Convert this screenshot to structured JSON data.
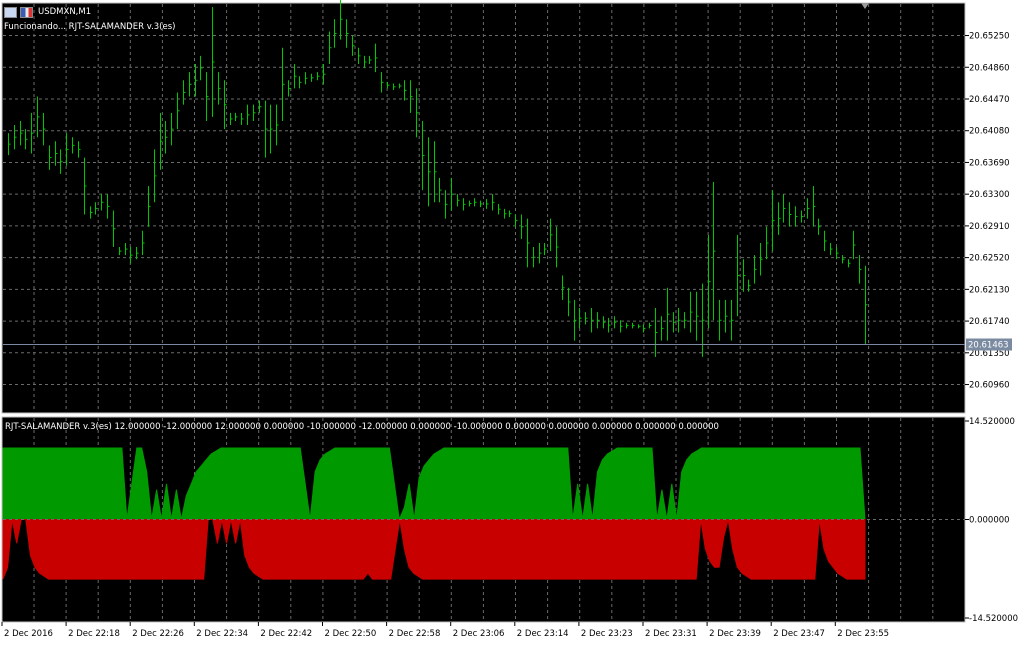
{
  "window": {
    "symbol_title": "USDMXN,M1",
    "status_text": "Funcionando... RJT-SALAMANDER v.3(es)"
  },
  "indicator": {
    "label": "RJT-SALAMANDER v.3(es) 12.000000 -12.000000 12.000000 0.000000 -10.000000 -12.000000 0.000000 -10.000000 0.000000 0.000000 0.000000 0.000000 0.000000",
    "axis_labels": [
      "14.520000",
      "0.000000",
      "-14.520000"
    ]
  },
  "colors": {
    "background": "#000000",
    "grid": "#6a6a6a",
    "candles": "#00c800",
    "bid_line": "#7a8aa0",
    "green_fill": "#009a00",
    "red_fill": "#c80000",
    "axis_panel": "#ffffff"
  },
  "price_axis": {
    "labels": [
      "20.65250",
      "20.64860",
      "20.64470",
      "20.64080",
      "20.63690",
      "20.63300",
      "20.62910",
      "20.62520",
      "20.62130",
      "20.61740",
      "20.61350",
      "20.60960"
    ],
    "current_price": "20.61463"
  },
  "time_axis": {
    "labels": [
      "2 Dec 2016",
      "2 Dec 22:18",
      "2 Dec 22:26",
      "2 Dec 22:34",
      "2 Dec 22:42",
      "2 Dec 22:50",
      "2 Dec 22:58",
      "2 Dec 23:06",
      "2 Dec 23:14",
      "2 Dec 23:23",
      "2 Dec 23:31",
      "2 Dec 23:39",
      "2 Dec 23:47",
      "2 Dec 23:55"
    ]
  },
  "chart_data": {
    "type": "line",
    "price_ylim": [
      20.6061,
      20.6565
    ],
    "bid": 20.61463,
    "price_bars_hl": [
      [
        20.6378,
        20.6405
      ],
      [
        20.6385,
        20.6415
      ],
      [
        20.639,
        20.642
      ],
      [
        20.6385,
        20.641
      ],
      [
        20.638,
        20.643
      ],
      [
        20.64,
        20.645
      ],
      [
        20.639,
        20.643
      ],
      [
        20.636,
        20.639
      ],
      [
        20.6365,
        20.6395
      ],
      [
        20.6355,
        20.6385
      ],
      [
        20.6365,
        20.6405
      ],
      [
        20.638,
        20.64
      ],
      [
        20.6375,
        20.6395
      ],
      [
        20.6305,
        20.6375
      ],
      [
        20.63,
        20.6315
      ],
      [
        20.6305,
        20.632
      ],
      [
        20.631,
        20.633
      ],
      [
        20.63,
        20.633
      ],
      [
        20.6265,
        20.631
      ],
      [
        20.6255,
        20.6265
      ],
      [
        20.6255,
        20.627
      ],
      [
        20.6245,
        20.6265
      ],
      [
        20.625,
        20.6265
      ],
      [
        20.6255,
        20.6285
      ],
      [
        20.629,
        20.634
      ],
      [
        20.632,
        20.6385
      ],
      [
        20.636,
        20.643
      ],
      [
        20.638,
        20.642
      ],
      [
        20.639,
        20.643
      ],
      [
        20.641,
        20.6455
      ],
      [
        20.644,
        20.647
      ],
      [
        20.645,
        20.648
      ],
      [
        20.645,
        20.649
      ],
      [
        20.647,
        20.65
      ],
      [
        20.642,
        20.648
      ],
      [
        20.6425,
        20.656
      ],
      [
        20.644,
        20.648
      ],
      [
        20.641,
        20.647
      ],
      [
        20.6415,
        20.643
      ],
      [
        20.642,
        20.643
      ],
      [
        20.6415,
        20.643
      ],
      [
        20.6415,
        20.644
      ],
      [
        20.642,
        20.644
      ],
      [
        20.643,
        20.6445
      ],
      [
        20.6375,
        20.6445
      ],
      [
        20.638,
        20.644
      ],
      [
        20.639,
        20.644
      ],
      [
        20.642,
        20.651
      ],
      [
        20.645,
        20.647
      ],
      [
        20.646,
        20.649
      ],
      [
        20.646,
        20.6475
      ],
      [
        20.6465,
        20.648
      ],
      [
        20.6468,
        20.6478
      ],
      [
        20.647,
        20.648
      ],
      [
        20.6465,
        20.649
      ],
      [
        20.649,
        20.653
      ],
      [
        20.651,
        20.6545
      ],
      [
        20.652,
        20.657
      ],
      [
        20.651,
        20.6545
      ],
      [
        20.65,
        20.6525
      ],
      [
        20.649,
        20.651
      ],
      [
        20.6485,
        20.65
      ],
      [
        20.649,
        20.65
      ],
      [
        20.648,
        20.6515
      ],
      [
        20.6455,
        20.648
      ],
      [
        20.646,
        20.6468
      ],
      [
        20.6458,
        20.6466
      ],
      [
        20.646,
        20.6466
      ],
      [
        20.6445,
        20.647
      ],
      [
        20.643,
        20.647
      ],
      [
        20.64,
        20.646
      ],
      [
        20.6335,
        20.642
      ],
      [
        20.6315,
        20.64
      ],
      [
        20.632,
        20.6395
      ],
      [
        20.632,
        20.635
      ],
      [
        20.63,
        20.6335
      ],
      [
        20.631,
        20.635
      ],
      [
        20.6315,
        20.633
      ],
      [
        20.631,
        20.6325
      ],
      [
        20.6315,
        20.6322
      ],
      [
        20.6315,
        20.6325
      ],
      [
        20.6314,
        20.6322
      ],
      [
        20.6312,
        20.6324
      ],
      [
        20.631,
        20.633
      ],
      [
        20.6305,
        20.6318
      ],
      [
        20.63,
        20.6312
      ],
      [
        20.6302,
        20.631
      ],
      [
        20.629,
        20.6305
      ],
      [
        20.6275,
        20.6305
      ],
      [
        20.624,
        20.63
      ],
      [
        20.624,
        20.6265
      ],
      [
        20.6245,
        20.627
      ],
      [
        20.6255,
        20.627
      ],
      [
        20.626,
        20.63
      ],
      [
        20.624,
        20.629
      ],
      [
        20.62,
        20.623
      ],
      [
        20.618,
        20.6215
      ],
      [
        20.615,
        20.62
      ],
      [
        20.6165,
        20.619
      ],
      [
        20.617,
        20.6185
      ],
      [
        20.616,
        20.619
      ],
      [
        20.6165,
        20.6185
      ],
      [
        20.6165,
        20.618
      ],
      [
        20.616,
        20.6178
      ],
      [
        20.6165,
        20.618
      ],
      [
        20.616,
        20.6175
      ],
      [
        20.6165,
        20.6172
      ],
      [
        20.6165,
        20.6172
      ],
      [
        20.6165,
        20.617
      ],
      [
        20.616,
        20.617
      ],
      [
        20.6165,
        20.6172
      ],
      [
        20.613,
        20.619
      ],
      [
        20.615,
        20.618
      ],
      [
        20.615,
        20.6215
      ],
      [
        20.616,
        20.6185
      ],
      [
        20.616,
        20.619
      ],
      [
        20.6165,
        20.6185
      ],
      [
        20.616,
        20.621
      ],
      [
        20.615,
        20.621
      ],
      [
        20.613,
        20.622
      ],
      [
        20.6165,
        20.628
      ],
      [
        20.6175,
        20.6345
      ],
      [
        20.615,
        20.62
      ],
      [
        20.616,
        20.62
      ],
      [
        20.615,
        20.62
      ],
      [
        20.618,
        20.628
      ],
      [
        20.621,
        20.625
      ],
      [
        20.621,
        20.6225
      ],
      [
        20.622,
        20.6255
      ],
      [
        20.623,
        20.627
      ],
      [
        20.625,
        20.629
      ],
      [
        20.626,
        20.6335
      ],
      [
        20.628,
        20.632
      ],
      [
        20.6295,
        20.633
      ],
      [
        20.629,
        20.632
      ],
      [
        20.629,
        20.6315
      ],
      [
        20.6295,
        20.631
      ],
      [
        20.63,
        20.6325
      ],
      [
        20.629,
        20.634
      ],
      [
        20.628,
        20.63
      ],
      [
        20.626,
        20.6285
      ],
      [
        20.6255,
        20.627
      ],
      [
        20.625,
        20.6265
      ],
      [
        20.6245,
        20.6255
      ],
      [
        20.624,
        20.625
      ],
      [
        20.625,
        20.6285
      ],
      [
        20.622,
        20.6255
      ],
      [
        20.6146,
        20.6242
      ]
    ],
    "oscillator_ylim": [
      -14.52,
      14.52
    ],
    "green_series": [
      12,
      12,
      12,
      12,
      12,
      12,
      12,
      12,
      12,
      12,
      12,
      12,
      12,
      12,
      12,
      12,
      12,
      12,
      12,
      12,
      12,
      12,
      12,
      12,
      12,
      0,
      6,
      12,
      12,
      8,
      0,
      5,
      0,
      6,
      0,
      5,
      0,
      4,
      6,
      8,
      9,
      10,
      11,
      11.5,
      12,
      12,
      12,
      12,
      12,
      12,
      12,
      12,
      12,
      12,
      12,
      12,
      12,
      12,
      12,
      12,
      12,
      6,
      0,
      8,
      10,
      11,
      11.5,
      12,
      12,
      12,
      12,
      12,
      12,
      12,
      12,
      12,
      12,
      12,
      12,
      6,
      0,
      2,
      6,
      0,
      7,
      9,
      10,
      11,
      11.5,
      12,
      12,
      12,
      12,
      12,
      12,
      12,
      12,
      12,
      12,
      12,
      12,
      12,
      12,
      12,
      12,
      12,
      12,
      12,
      12,
      12,
      12,
      12,
      12,
      12,
      12,
      0,
      6,
      0,
      6,
      0,
      8,
      10,
      11,
      11.5,
      12,
      12,
      12,
      12,
      12,
      12,
      12,
      12,
      0,
      5,
      0,
      6,
      0,
      8,
      10,
      11,
      11.5,
      12,
      12,
      12,
      12,
      12,
      12,
      12,
      12,
      12,
      12,
      12,
      12,
      12,
      12,
      12,
      12,
      12,
      12,
      12,
      12,
      12,
      12,
      12,
      12,
      12,
      12,
      12,
      12,
      12,
      12,
      12,
      12,
      12,
      0
    ],
    "red_series": [
      -10,
      -8,
      0,
      -4,
      0,
      0,
      -6,
      -8,
      -9,
      -9.5,
      -10,
      -10,
      -10,
      -10,
      -10,
      -10,
      -10,
      -10,
      -10,
      -10,
      -10,
      -10,
      -10,
      -10,
      -10,
      -10,
      -10,
      -10,
      -10,
      -10,
      -10,
      -10,
      -10,
      -10,
      -10,
      -10,
      -10,
      -10,
      -10,
      -10,
      -10,
      -10,
      -10,
      -10,
      -10,
      0,
      0,
      -4,
      0,
      -4,
      0,
      -4,
      0,
      -6,
      -8,
      -9,
      -9.5,
      -10,
      -10,
      -10,
      -10,
      -10,
      -10,
      -10,
      -10,
      -10,
      -10,
      -10,
      -10,
      -10,
      -10,
      -10,
      -10,
      -10,
      -10,
      -10,
      -10,
      -10,
      -10,
      -10,
      -9,
      -10,
      -10,
      -10,
      -10,
      -10,
      -5,
      0,
      -5,
      -8,
      -9,
      -9.5,
      -10,
      -10,
      -10,
      -10,
      -10,
      -10,
      -10,
      -10,
      -10,
      -10,
      -10,
      -10,
      -10,
      -10,
      -10,
      -10,
      -10,
      -10,
      -10,
      -10,
      -10,
      -10,
      -10,
      -10,
      -10,
      -10,
      -10,
      -10,
      -10,
      -10,
      -10,
      -10,
      -10,
      -10,
      -10,
      -10,
      -10,
      -10,
      -10,
      -10,
      -10,
      -10,
      -10,
      -10,
      -10,
      -10,
      -10,
      -10,
      -10,
      -10,
      -10,
      -10,
      -10,
      -10,
      -10,
      -10,
      -10,
      -10,
      -10,
      -10,
      -10,
      0,
      -5,
      -7,
      -8,
      -8,
      -3,
      0,
      -5,
      -8,
      -9,
      -9.5,
      -10,
      -10,
      -10,
      -10,
      -10,
      -10,
      -10,
      -10,
      -10,
      -10,
      -10,
      -10,
      -10,
      -10,
      -10,
      0,
      -5,
      -7,
      -8,
      -9,
      -9.5,
      -10,
      -10,
      -10,
      -10,
      -10
    ]
  }
}
